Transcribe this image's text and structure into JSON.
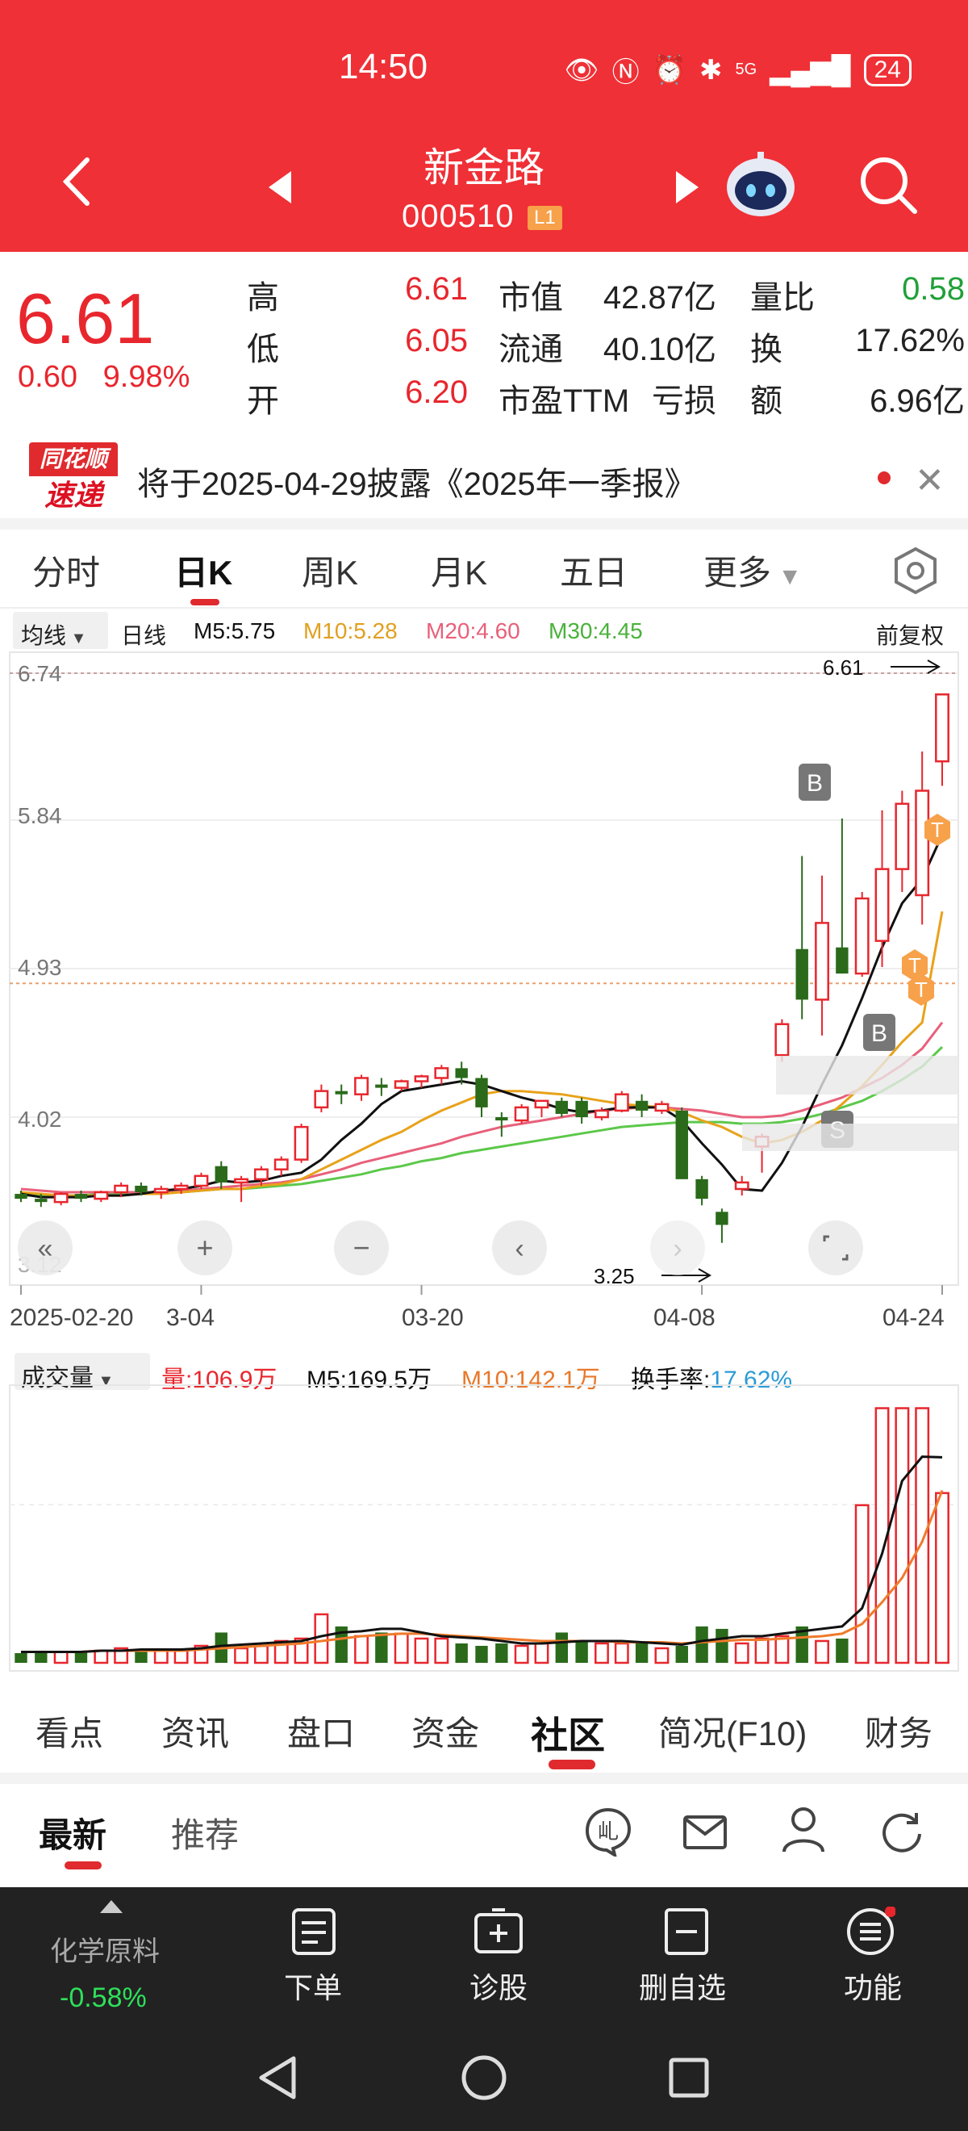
{
  "status": {
    "time": "14:50",
    "signal": "5G",
    "battery": "24"
  },
  "header": {
    "name": "新金路",
    "code": "000510",
    "level": "L1"
  },
  "quote": {
    "price": "6.61",
    "change": "0.60",
    "change_pct": "9.98%",
    "high_label": "高",
    "high": "6.61",
    "low_label": "低",
    "low": "6.05",
    "open_label": "开",
    "open": "6.20",
    "mcap_label": "市值",
    "mcap": "42.87亿",
    "float_label": "流通",
    "float": "40.10亿",
    "pe_label": "市盈TTM",
    "pe": "亏损",
    "vr_label": "量比",
    "vr": "0.58",
    "turn_label": "换",
    "turn": "17.62%",
    "amount_label": "额",
    "amount": "6.96亿"
  },
  "news": {
    "logo_top": "同花顺",
    "logo_bottom": "速递",
    "text": "将于2025-04-29披露《2025年一季报》"
  },
  "ktabs": [
    "分时",
    "日K",
    "周K",
    "月K",
    "五日",
    "更多"
  ],
  "ma": {
    "btn": "均线",
    "type": "日线",
    "m5": "M5:5.75",
    "m10": "M10:5.28",
    "m20": "M20:4.60",
    "m30": "M30:4.45",
    "adj": "前复权"
  },
  "price_axis": [
    "6.74",
    "5.84",
    "4.93",
    "4.02",
    "3.12"
  ],
  "date_axis": [
    "2025-02-20",
    "3-04",
    "03-20",
    "04-08",
    "04-24"
  ],
  "annot": {
    "high": "6.61",
    "low": "3.25"
  },
  "signals": {
    "b": "B",
    "s": "S",
    "t": "T"
  },
  "vol": {
    "btn": "成交量",
    "v": "量:106.9万",
    "m5": "M5:169.5万",
    "m10": "M10:142.1万",
    "turn_label": "换手率:",
    "turn": "17.62%"
  },
  "colors": {
    "red": "#e8262d",
    "green": "#2a6a1a",
    "ma5": "#111111",
    "ma10": "#e8a21a",
    "ma20": "#e8607a",
    "ma30": "#5cc84a"
  },
  "chart_data": {
    "type": "candlestick",
    "candles": [
      [
        3.55,
        3.57,
        3.5,
        3.52
      ],
      [
        3.52,
        3.55,
        3.47,
        3.5
      ],
      [
        3.5,
        3.56,
        3.48,
        3.55
      ],
      [
        3.55,
        3.57,
        3.5,
        3.52
      ],
      [
        3.52,
        3.57,
        3.5,
        3.56
      ],
      [
        3.56,
        3.62,
        3.53,
        3.6
      ],
      [
        3.6,
        3.62,
        3.54,
        3.56
      ],
      [
        3.56,
        3.6,
        3.52,
        3.58
      ],
      [
        3.58,
        3.62,
        3.55,
        3.6
      ],
      [
        3.6,
        3.68,
        3.58,
        3.66
      ],
      [
        3.72,
        3.75,
        3.58,
        3.62
      ],
      [
        3.62,
        3.66,
        3.5,
        3.64
      ],
      [
        3.64,
        3.72,
        3.6,
        3.7
      ],
      [
        3.7,
        3.78,
        3.66,
        3.76
      ],
      [
        3.76,
        3.98,
        3.74,
        3.96
      ],
      [
        4.08,
        4.22,
        4.05,
        4.18
      ],
      [
        4.18,
        4.22,
        4.1,
        4.16
      ],
      [
        4.16,
        4.28,
        4.12,
        4.26
      ],
      [
        4.22,
        4.26,
        4.15,
        4.2
      ],
      [
        4.2,
        4.25,
        4.18,
        4.24
      ],
      [
        4.24,
        4.28,
        4.2,
        4.27
      ],
      [
        4.26,
        4.34,
        4.22,
        4.32
      ],
      [
        4.32,
        4.36,
        4.22,
        4.26
      ],
      [
        4.26,
        4.28,
        4.02,
        4.08
      ],
      [
        4.02,
        4.05,
        3.9,
        4.0
      ],
      [
        4.0,
        4.1,
        3.98,
        4.08
      ],
      [
        4.08,
        4.12,
        4.02,
        4.12
      ],
      [
        4.12,
        4.14,
        4.02,
        4.04
      ],
      [
        4.12,
        4.14,
        3.98,
        4.02
      ],
      [
        4.02,
        4.08,
        4.0,
        4.06
      ],
      [
        4.06,
        4.18,
        4.05,
        4.16
      ],
      [
        4.12,
        4.16,
        4.02,
        4.06
      ],
      [
        4.06,
        4.12,
        4.04,
        4.1
      ],
      [
        4.06,
        4.08,
        3.8,
        3.64
      ],
      [
        3.64,
        3.66,
        3.48,
        3.52
      ],
      [
        3.44,
        3.46,
        3.25,
        3.36
      ],
      [
        3.58,
        3.66,
        3.54,
        3.62
      ],
      [
        3.84,
        3.92,
        3.68,
        3.9
      ],
      [
        4.4,
        4.62,
        4.36,
        4.59
      ],
      [
        5.05,
        5.62,
        4.62,
        4.74
      ],
      [
        4.74,
        5.5,
        4.52,
        5.21
      ],
      [
        5.06,
        5.85,
        4.9,
        4.9
      ],
      [
        4.9,
        5.4,
        4.88,
        5.36
      ],
      [
        5.1,
        5.9,
        4.94,
        5.54
      ],
      [
        5.54,
        6.02,
        5.4,
        5.94
      ],
      [
        5.38,
        6.26,
        5.2,
        6.02
      ],
      [
        6.2,
        6.61,
        6.05,
        6.61
      ]
    ],
    "ma5": [
      3.55,
      3.53,
      3.53,
      3.53,
      3.54,
      3.54,
      3.55,
      3.57,
      3.58,
      3.6,
      3.63,
      3.62,
      3.63,
      3.66,
      3.68,
      3.76,
      3.88,
      3.98,
      4.1,
      4.18,
      4.2,
      4.22,
      4.24,
      4.22,
      4.18,
      4.14,
      4.11,
      4.07,
      4.05,
      4.06,
      4.08,
      4.08,
      4.08,
      4.0,
      3.86,
      3.73,
      3.58,
      3.57,
      3.74,
      3.96,
      4.22,
      4.46,
      4.75,
      5.06,
      5.33,
      5.48,
      5.75
    ],
    "ma10": [
      3.56,
      3.55,
      3.54,
      3.54,
      3.54,
      3.54,
      3.55,
      3.55,
      3.56,
      3.57,
      3.58,
      3.58,
      3.6,
      3.61,
      3.64,
      3.7,
      3.76,
      3.82,
      3.88,
      3.93,
      4.0,
      4.06,
      4.11,
      4.16,
      4.18,
      4.18,
      4.17,
      4.16,
      4.14,
      4.12,
      4.1,
      4.09,
      4.08,
      4.05,
      4.0,
      3.96,
      3.9,
      3.86,
      3.88,
      3.93,
      4.0,
      4.1,
      4.21,
      4.34,
      4.48,
      4.6,
      5.28
    ],
    "ma20": [
      3.58,
      3.57,
      3.56,
      3.56,
      3.56,
      3.56,
      3.56,
      3.56,
      3.57,
      3.58,
      3.59,
      3.6,
      3.61,
      3.62,
      3.64,
      3.67,
      3.7,
      3.74,
      3.77,
      3.8,
      3.83,
      3.86,
      3.9,
      3.93,
      3.96,
      3.98,
      4.0,
      4.02,
      4.04,
      4.06,
      4.07,
      4.08,
      4.08,
      4.07,
      4.06,
      4.04,
      4.02,
      4.02,
      4.03,
      4.06,
      4.1,
      4.14,
      4.2,
      4.26,
      4.34,
      4.44,
      4.6
    ],
    "ma30": [
      3.54,
      3.54,
      3.54,
      3.54,
      3.55,
      3.55,
      3.55,
      3.56,
      3.56,
      3.57,
      3.58,
      3.58,
      3.59,
      3.6,
      3.61,
      3.63,
      3.65,
      3.67,
      3.7,
      3.72,
      3.75,
      3.77,
      3.8,
      3.82,
      3.84,
      3.86,
      3.88,
      3.9,
      3.92,
      3.94,
      3.96,
      3.97,
      3.98,
      3.99,
      3.99,
      3.99,
      3.98,
      3.98,
      3.99,
      4.01,
      4.04,
      4.08,
      4.12,
      4.18,
      4.25,
      4.33,
      4.45
    ],
    "volume": [
      8,
      10,
      9,
      9,
      10,
      12,
      9,
      11,
      10,
      14,
      25,
      12,
      14,
      18,
      20,
      40,
      30,
      22,
      25,
      24,
      20,
      20,
      16,
      14,
      16,
      14,
      16,
      25,
      18,
      16,
      16,
      16,
      12,
      14,
      30,
      28,
      16,
      20,
      22,
      30,
      18,
      20,
      130,
      210,
      210,
      210,
      140
    ],
    "vol_ma5": [
      9,
      9,
      9,
      9,
      10,
      10,
      11,
      11,
      11,
      12,
      14,
      15,
      16,
      17,
      18,
      22,
      25,
      26,
      28,
      28,
      25,
      22,
      21,
      20,
      18,
      16,
      16,
      17,
      18,
      18,
      18,
      17,
      16,
      15,
      18,
      20,
      22,
      22,
      24,
      26,
      28,
      30,
      45,
      90,
      150,
      170,
      169.5
    ],
    "vol_ma10": [
      9,
      9,
      9,
      9,
      10,
      10,
      10,
      10,
      10,
      11,
      12,
      13,
      14,
      15,
      16,
      18,
      20,
      22,
      23,
      24,
      24,
      23,
      22,
      21,
      20,
      19,
      18,
      18,
      18,
      18,
      17,
      17,
      17,
      16,
      17,
      18,
      19,
      19,
      20,
      21,
      22,
      24,
      32,
      50,
      70,
      100,
      142.1
    ]
  }
}
